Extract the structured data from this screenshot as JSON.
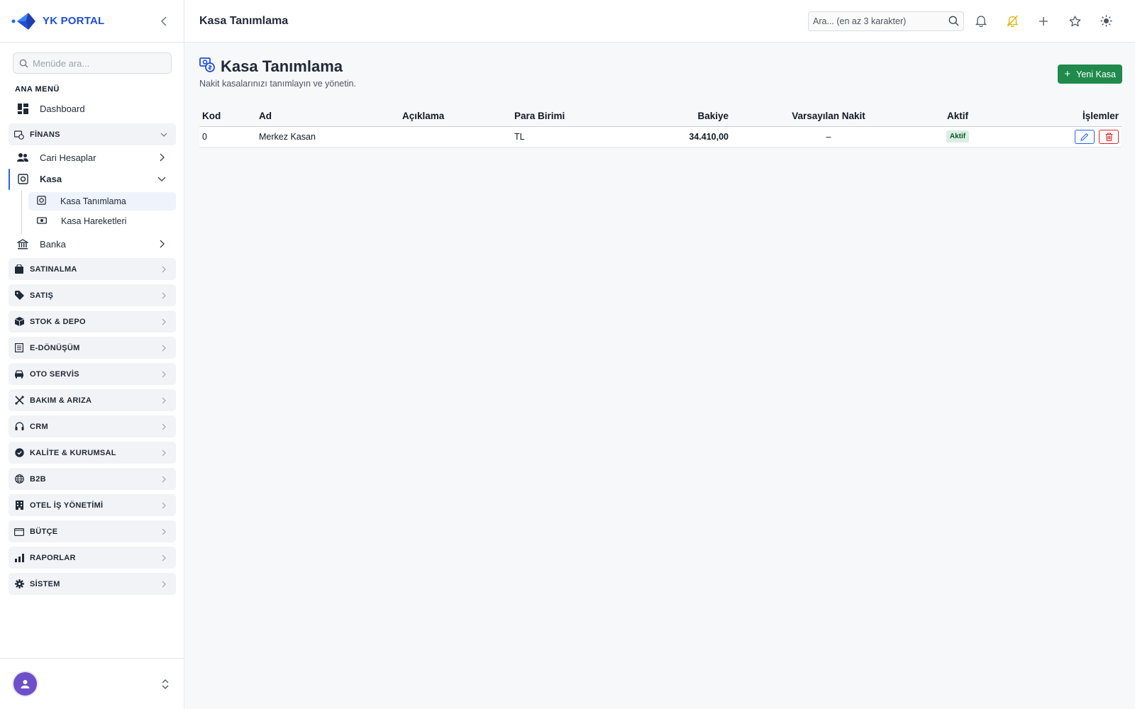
{
  "brand": {
    "name": "YK PORTAL"
  },
  "sidebar": {
    "search_placeholder": "Menüde ara...",
    "section_title": "ANA MENÜ",
    "dashboard": "Dashboard",
    "finans": {
      "label": "FİNANS",
      "items": {
        "cari": "Cari Hesaplar",
        "kasa": "Kasa",
        "kasa_tanimlama": "Kasa Tanımlama",
        "kasa_hareketleri": "Kasa Hareketleri",
        "banka": "Banka"
      }
    },
    "groups": {
      "satinalma": "SATINALMA",
      "satis": "SATIŞ",
      "stok": "STOK & DEPO",
      "edonusum": "E-DÖNÜŞÜM",
      "oto": "OTO SERVİS",
      "bakim": "BAKIM & ARIZA",
      "crm": "CRM",
      "kalite": "KALİTE & KURUMSAL",
      "b2b": "B2B",
      "otel": "OTEL İŞ YÖNETİMİ",
      "butce": "BÜTÇE",
      "raporlar": "RAPORLAR",
      "sistem": "SİSTEM"
    }
  },
  "header": {
    "title": "Kasa Tanımlama",
    "search_placeholder": "Ara... (en az 3 karakter)"
  },
  "page": {
    "title": "Kasa Tanımlama",
    "subtitle": "Nakit kasalarınızı tanımlayın ve yönetin.",
    "new_button": "Yeni Kasa"
  },
  "table": {
    "headers": {
      "kod": "Kod",
      "ad": "Ad",
      "aciklama": "Açıklama",
      "para_birimi": "Para Birimi",
      "bakiye": "Bakiye",
      "varsayilan": "Varsayılan Nakit",
      "aktif": "Aktif",
      "islemler": "İşlemler"
    },
    "rows": [
      {
        "kod": "0",
        "ad": "Merkez Kasan",
        "aciklama": "",
        "para_birimi": "TL",
        "bakiye": "34.410,00",
        "varsayilan": "–",
        "aktif": "Aktif"
      }
    ]
  },
  "colors": {
    "accent": "#1d4ed8",
    "primary_button": "#1f8a4c",
    "danger": "#dc2626",
    "avatar": "#6d4fc9"
  }
}
